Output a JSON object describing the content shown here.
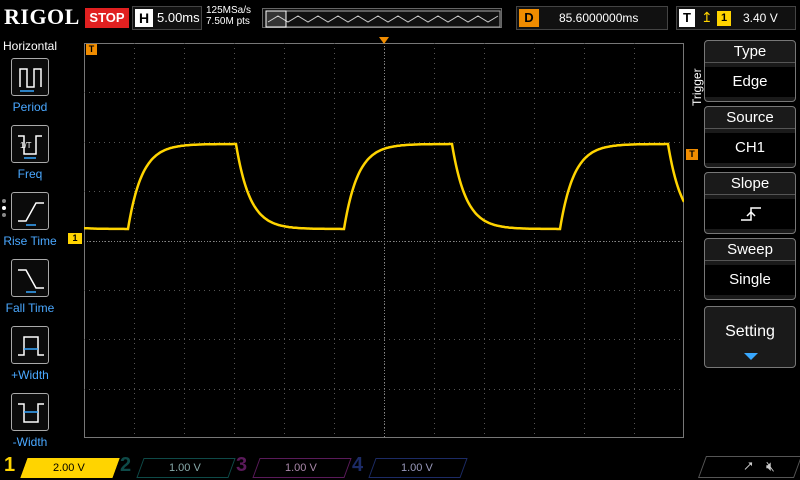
{
  "topbar": {
    "brand": "RIGOL",
    "run_state": "STOP",
    "timebase_label": "H",
    "timebase_value": "5.00ms",
    "sample_rate": "125MSa/s",
    "memory_depth": "7.50M pts",
    "delay_label": "D",
    "delay_value": "85.6000000ms",
    "trigger_label": "T",
    "trigger_source_badge": "1",
    "trigger_level": "3.40 V"
  },
  "leftbar": {
    "title": "Horizontal",
    "items": [
      {
        "label": "Period",
        "icon": "period-icon"
      },
      {
        "label": "Freq",
        "icon": "frequency-icon"
      },
      {
        "label": "Rise Time",
        "icon": "rise-time-icon"
      },
      {
        "label": "Fall Time",
        "icon": "fall-time-icon"
      },
      {
        "label": "+Width",
        "icon": "positive-width-icon"
      },
      {
        "label": "-Width",
        "icon": "negative-width-icon"
      }
    ]
  },
  "screen": {
    "ch1_marker": "1",
    "trigger_marker": "T",
    "waveform_color": "#ffd400",
    "grid_color": "#555555"
  },
  "rightmenu": {
    "tab_label": "Trigger",
    "items": [
      {
        "title": "Type",
        "value": "Edge"
      },
      {
        "title": "Source",
        "value": "CH1"
      },
      {
        "title": "Slope",
        "value": ""
      },
      {
        "title": "Sweep",
        "value": "Single"
      }
    ],
    "setting_label": "Setting"
  },
  "bottombar": {
    "channels": [
      {
        "num": "1",
        "scale": "2.00 V"
      },
      {
        "num": "2",
        "scale": "1.00 V"
      },
      {
        "num": "3",
        "scale": "1.00 V"
      },
      {
        "num": "4",
        "scale": "1.00 V"
      }
    ]
  }
}
